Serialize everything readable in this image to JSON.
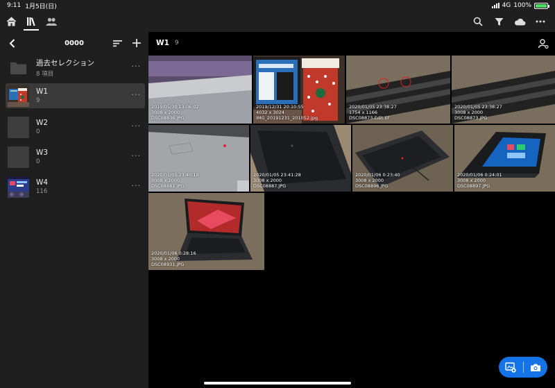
{
  "status_bar": {
    "time": "9:11",
    "date": "1月5日(日)",
    "network": "4G",
    "battery": "100%",
    "battery_level": 1.0
  },
  "top_nav": {
    "tabs": [
      {
        "icon": "home-icon",
        "active": false
      },
      {
        "icon": "library-icon",
        "active": true
      },
      {
        "icon": "people-icon",
        "active": false
      }
    ],
    "actions": [
      "search-icon",
      "filter-icon",
      "cloud-icon",
      "more-icon"
    ]
  },
  "sidebar": {
    "title": "0000",
    "albums": [
      {
        "name": "過去セレクション",
        "count": "8 項目",
        "type": "folder"
      },
      {
        "name": "W1",
        "count": "9",
        "selected": true
      },
      {
        "name": "W2",
        "count": "0"
      },
      {
        "name": "W3",
        "count": "0"
      },
      {
        "name": "W4",
        "count": "116"
      }
    ]
  },
  "main": {
    "title": "W1",
    "count": "9",
    "photos": [
      {
        "date": "2019/05/30 13:06:02",
        "size": "3008 x 2000",
        "file": "DSC08836.JPG"
      },
      {
        "date": "2019/12/31 20:10:55",
        "size": "4032 x 3024",
        "file": "IMG_20191231_201052.jpg"
      },
      {
        "date": "2020/01/05 23:38:27",
        "size": "1754 x 1166",
        "file": "DSC08873-Edit.tif"
      },
      {
        "date": "2020/01/05 23:38:27",
        "size": "3008 x 2000",
        "file": "DSC08873.JPG"
      },
      {
        "date": "2020/01/05 23:40:18",
        "size": "3008 x 2000",
        "file": "DSC08881.JPG"
      },
      {
        "date": "2020/01/05 23:41:28",
        "size": "3008 x 2000",
        "file": "DSC08887.JPG"
      },
      {
        "date": "2020/01/06 0:23:40",
        "size": "3008 x 2000",
        "file": "DSC08896.JPG"
      },
      {
        "date": "2020/01/06 0:24:01",
        "size": "3008 x 2000",
        "file": "DSC08897.JPG"
      },
      {
        "date": "2020/01/06 0:28:16",
        "size": "3008 x 2000",
        "file": "DSC08931.JPG"
      }
    ]
  },
  "fab": {
    "left_icon": "import-photo-icon",
    "right_icon": "camera-icon"
  },
  "colors": {
    "accent": "#1473e6",
    "panel": "#1f1f1f",
    "selected": "#3a3a3a",
    "background": "#000000"
  }
}
